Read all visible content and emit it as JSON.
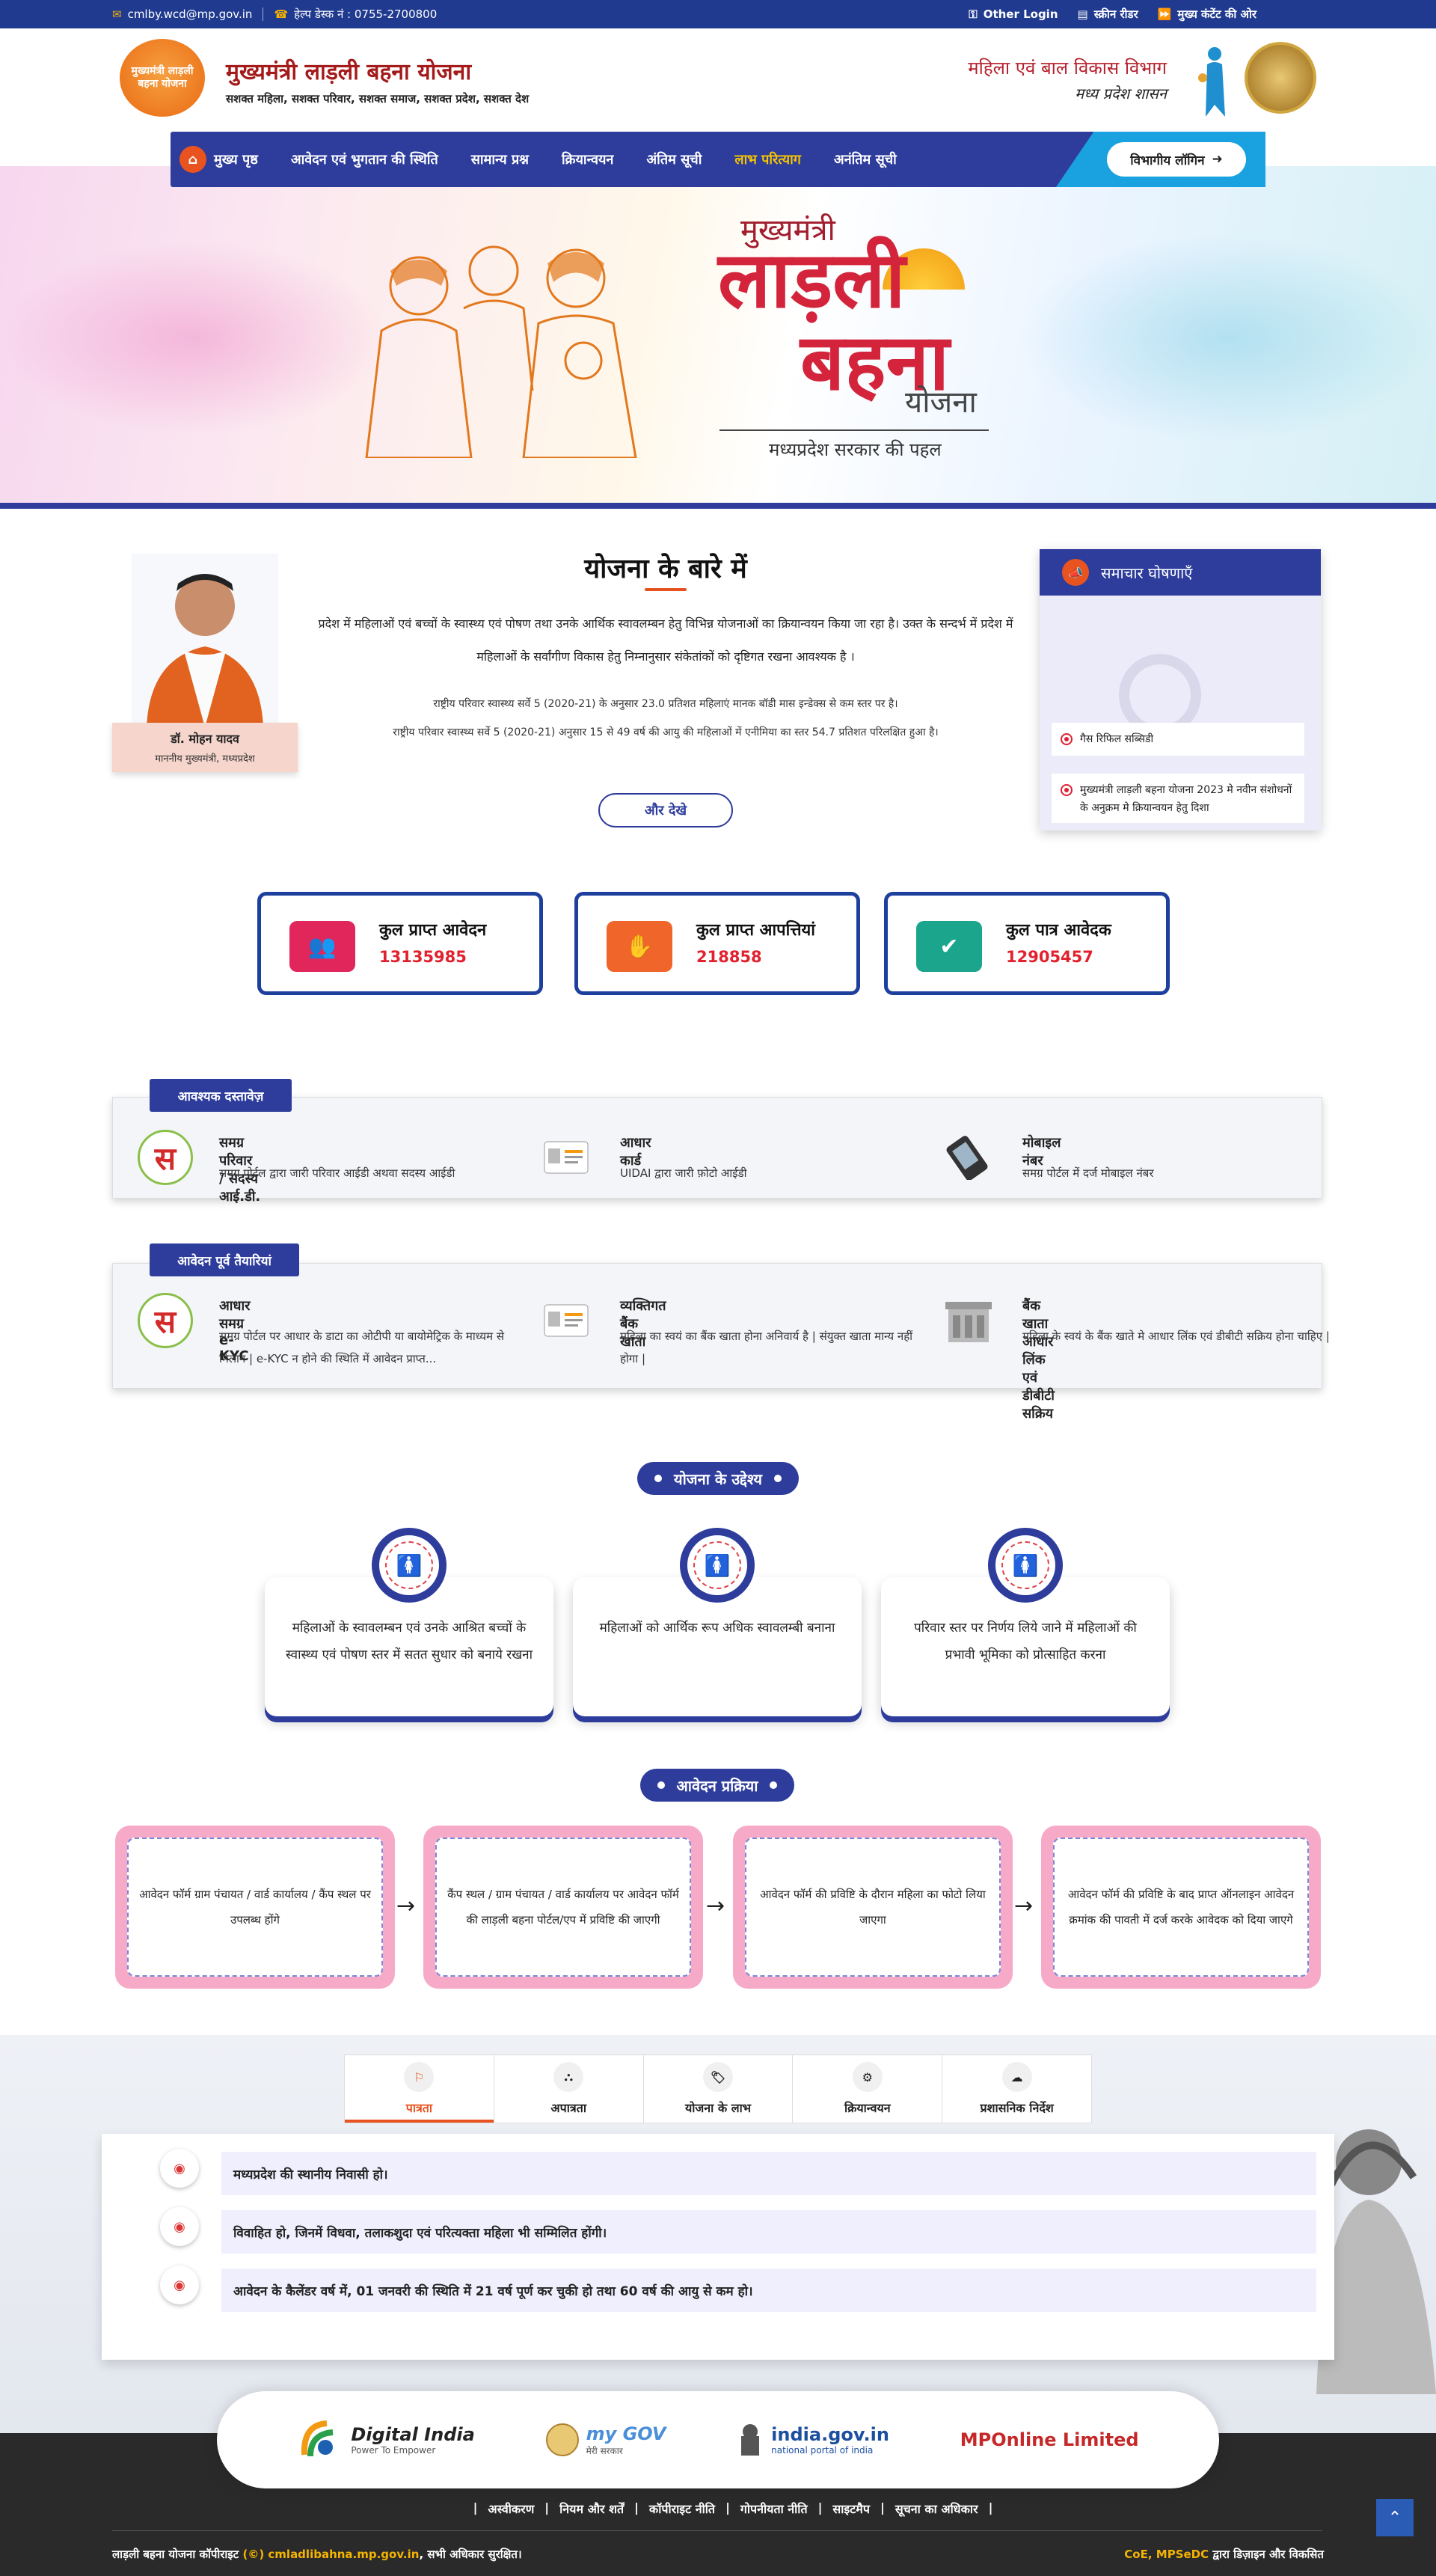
{
  "topbar": {
    "email": "cmlby.wcd@mp.gov.in",
    "helpdesk": "हेल्प डेस्क नं : 0755-2700800",
    "other_login": "Other Login",
    "screen_reader": "स्क्रीन रीडर",
    "skip": "मुख्य कंटेंट की ओर"
  },
  "header": {
    "logo_text": "मुख्यमंत्री लाड़ली बहना योजना",
    "title": "मुख्यमंत्री लाड़ली बहना योजना",
    "subtitle": "सशक्त महिला, सशक्त परिवार, सशक्त समाज, सशक्त प्रदेश, सशक्त देश",
    "dept_line1": "महिला एवं बाल विकास विभाग",
    "dept_line2": "मध्य प्रदेश शासन"
  },
  "nav": {
    "items": [
      "मुख्य पृष्ठ",
      "आवेदन एवं भुगतान की स्थिति",
      "सामान्य प्रश्न",
      "क्रियान्वयन",
      "अंतिम सूची",
      "लाभ परित्याग",
      "अनंतिम सूची"
    ],
    "active_index": 5,
    "login": "विभागीय लॉगिन"
  },
  "hero": {
    "line1": "मुख्यमंत्री",
    "line2": "लाड़ली",
    "line3": "बहना",
    "line4": "योजना",
    "tagline": "मध्यप्रदेश सरकार की पहल"
  },
  "cm": {
    "name": "डॉ. मोहन यादव",
    "designation": "माननीय मुख्यमंत्री, मध्यप्रदेश"
  },
  "about": {
    "title": "योजना के बारे में",
    "para": "प्रदेश में महिलाओं एवं बच्चों के स्वास्थ्य एवं पोषण तथा उनके आर्थिक स्वावलम्बन हेतु विभिन्न योजनाओं का क्रियान्वयन किया जा रहा है। उक्त के सन्दर्भ में प्रदेश में महिलाओं के सर्वांगीण विकास हेतु निम्नानुसार संकेतांकों को दृष्टिगत रखना आवश्यक है ।",
    "stat1": "राष्ट्रीय परिवार स्वास्थ्य सर्वे 5 (2020-21) के अनुसार 23.0 प्रतिशत महिलाएं मानक बॉडी मास इन्डेक्स से कम स्तर पर है।",
    "stat2": "राष्ट्रीय परिवार स्वास्थ्य सर्वे 5 (2020-21) अनुसार 15 से 49 वर्ष की आयु की महिलाओं में एनीमिया का स्तर 54.7 प्रतिशत परिलक्षित हुआ है।",
    "more": "और देखे"
  },
  "news": {
    "title": "समाचार घोषणाएँ",
    "items": [
      "गैस रिफिल सब्सिडी",
      "मुख्यमंत्री लाड़ली बहना योजना 2023 मे नवीन संशोधनों के अनुक्रम मे क्रियान्वयन हेतु दिशा"
    ]
  },
  "stats": [
    {
      "label": "कुल प्राप्त आवेदन",
      "value": "13135985",
      "color": "#e0265b",
      "icon": "users-icon"
    },
    {
      "label": "कुल प्राप्त आपत्तियां",
      "value": "218858",
      "color": "#f0652a",
      "icon": "objection-icon"
    },
    {
      "label": "कुल पात्र आवेदक",
      "value": "12905457",
      "color": "#1aa58c",
      "icon": "eligible-icon"
    }
  ],
  "documents": {
    "tag": "आवश्यक दस्तावेज़",
    "items": [
      {
        "title": "समग्र परिवार / सदस्य आई.डी.",
        "desc": "समग्र पोर्टल द्वारा जारी परिवार आईडी अथवा सदस्य आईडी"
      },
      {
        "title": "आधार कार्ड",
        "desc": "UIDAI द्वारा जारी फ़ोटो आईडी"
      },
      {
        "title": "मोबाइल नंबर",
        "desc": "समग्र पोर्टल में दर्ज मोबाइल नंबर"
      }
    ]
  },
  "prep": {
    "tag": "आवेदन पूर्व तैयारियां",
    "items": [
      {
        "title": "आधार समग्र e-KYC",
        "desc": "समग्र पोर्टल पर आधार के डाटा का ओटीपी या बायोमेट्रिक के माध्यम से मिलान | e-KYC न होने की स्थिति में आवेदन प्राप्त..."
      },
      {
        "title": "व्यक्तिगत बैंक खाता",
        "desc": "महिला का स्वयं का बैंक खाता होना अनिवार्य है | संयुक्त खाता मान्य नहीं होगा |"
      },
      {
        "title": "बैंक खाता आधार लिंक एवं डीबीटी सक्रिय",
        "desc": "महिला के स्वयं के बैंक खाते मे आधार लिंक एवं डीबीटी सक्रिय होना चाहिए |"
      }
    ]
  },
  "objectives": {
    "title": "योजना के उद्देश्य",
    "items": [
      "महिलाओं के स्वावलम्बन एवं उनके आश्रित बच्चों के स्वास्थ्य एवं पोषण स्तर में सतत सुधार को बनाये रखना",
      "महिलाओं को आर्थिक रूप अधिक स्वावलम्बी बनाना",
      "परिवार स्तर पर निर्णय लिये जाने में महिलाओं की प्रभावी भूमिका को प्रोत्साहित करना"
    ]
  },
  "process": {
    "title": "आवेदन प्रक्रिया",
    "steps": [
      "आवेदन फॉर्म ग्राम पंचायत / वार्ड कार्यालय / कैंप स्थल पर उपलब्ध होंगे",
      "कैंप स्थल / ग्राम पंचायत / वार्ड कार्यालय पर आवेदन फॉर्म की लाड़ली बहना पोर्टल/एप में प्रविष्टि की जाएगी",
      "आवेदन फॉर्म की प्रविष्टि के दौरान महिला का फोटो लिया जाएगा",
      "आवेदन फॉर्म की प्रविष्टि के बाद प्राप्त ऑनलाइन आवेदन क्रमांक की पावती में दर्ज करके आवेदक को दिया जाएगे"
    ]
  },
  "tabs": {
    "items": [
      "पात्रता",
      "अपात्रता",
      "योजना के लाभ",
      "क्रियान्वयन",
      "प्रशासनिक निर्देश"
    ],
    "active_index": 0,
    "criteria": [
      "मध्यप्रदेश की स्थानीय निवासी हो।",
      "विवाहित हो, जिनमें विधवा, तलाकशुदा एवं परित्यक्ता महिला भी सम्मिलित होंगी।",
      "आवेदन के कैलेंडर वर्ष में, 01 जनवरी की स्थिति में 21 वर्ष पूर्ण कर चुकी हो तथा 60 वर्ष की आयु से कम हो।"
    ]
  },
  "partners": {
    "digital_india": "Digital India",
    "digital_india_sub": "Power To Empower",
    "mygov": "my GOV",
    "mygov_sub": "मेरी सरकार",
    "indiagov": "india.gov.in",
    "indiagov_sub": "national portal of india",
    "mponline": "MPOnline Limited"
  },
  "footer": {
    "links": [
      "अस्वीकरण",
      "नियम और शर्तें",
      "कॉपीराइट नीति",
      "गोपनीयता नीति",
      "साइटमैप",
      "सूचना का अधिकार"
    ],
    "copyright_pre": "लाड़ली बहना योजना कॉपीराइट",
    "copyright_site": "(©) cmladlibahna.mp.gov.in",
    "copyright_post": ", सभी अधिकार सुरक्षित।",
    "dev_org": "CoE, MPSeDC",
    "dev_text": "द्वारा डिज़ाइन और विकसित"
  }
}
